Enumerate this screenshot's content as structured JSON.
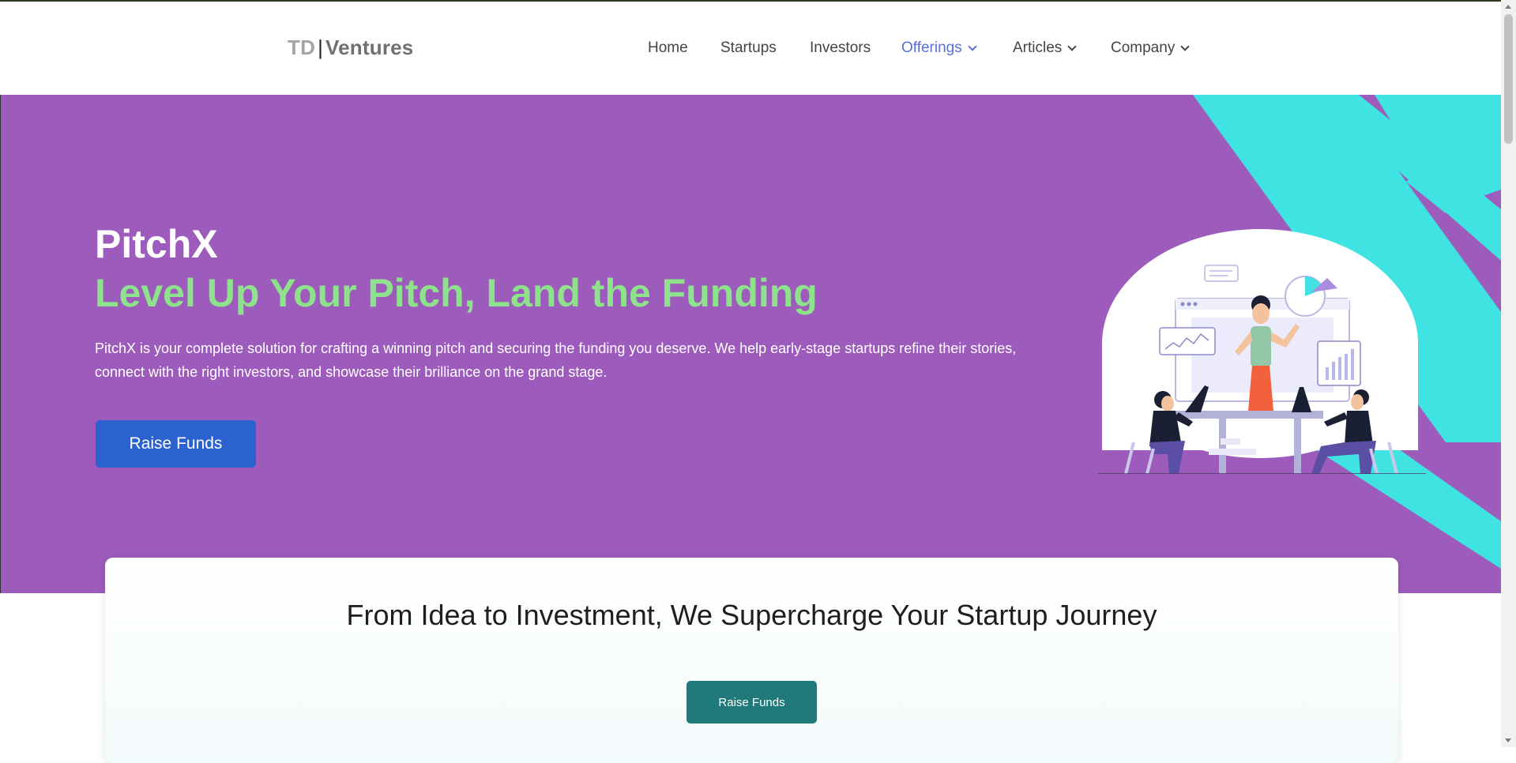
{
  "header": {
    "logo": {
      "td": "TD",
      "separator": "|",
      "ventures": "Ventures"
    },
    "nav": [
      {
        "label": "Home",
        "dropdown": false,
        "active": false
      },
      {
        "label": "Startups",
        "dropdown": false,
        "active": false
      },
      {
        "label": "Investors",
        "dropdown": false,
        "active": false
      },
      {
        "label": "Offerings",
        "dropdown": true,
        "active": true
      },
      {
        "label": "Articles",
        "dropdown": true,
        "active": false
      },
      {
        "label": "Company",
        "dropdown": true,
        "active": false
      }
    ]
  },
  "hero": {
    "title": "PitchX",
    "subtitle": "Level Up Your Pitch, Land the Funding",
    "description": "PitchX is your complete solution for crafting a winning pitch and securing the funding you deserve. We help early-stage startups refine their stories, connect with the right investors, and showcase their brilliance on the grand stage.",
    "cta_label": "Raise Funds"
  },
  "section": {
    "title": "From Idea to Investment, We Supercharge Your Startup Journey",
    "cta_label": "Raise Funds"
  },
  "colors": {
    "hero_bg": "#9d5cbb",
    "accent_green": "#8ee28c",
    "primary_button": "#2c62cf",
    "teal_button": "#207a7c",
    "nav_active": "#5b6fd6",
    "cyan_stripe": "#3ee3e2"
  }
}
